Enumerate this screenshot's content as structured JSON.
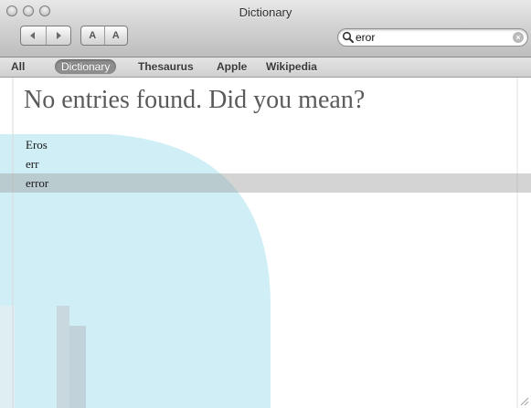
{
  "window": {
    "title": "Dictionary"
  },
  "toolbar": {
    "back_icon": "back-arrow-icon",
    "forward_icon": "forward-arrow-icon",
    "font_smaller_label": "A",
    "font_larger_label": "A"
  },
  "search": {
    "value": "eror",
    "icon": "magnifier-icon"
  },
  "scope": {
    "items": [
      "All",
      "Dictionary",
      "Thesaurus",
      "Apple",
      "Wikipedia"
    ],
    "selected": "Dictionary"
  },
  "content": {
    "heading": "No entries found. Did you mean?",
    "suggestions": [
      "Eros",
      "err",
      "error"
    ],
    "highlighted": "error"
  },
  "colors": {
    "accent_art": "#cdeef5",
    "highlight": "#d2d2d2",
    "heading_text": "#5a5a5a"
  }
}
